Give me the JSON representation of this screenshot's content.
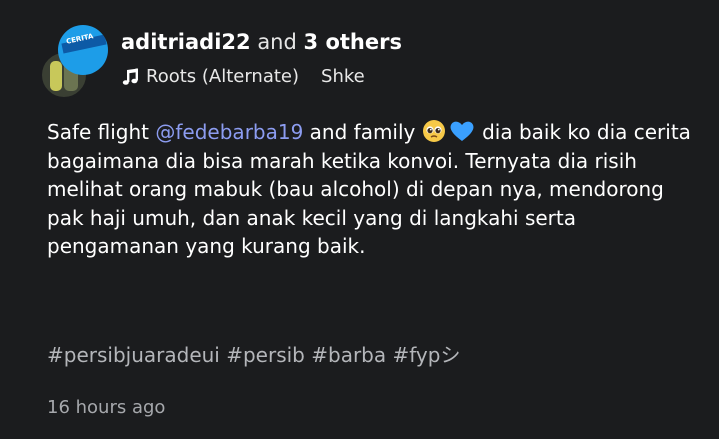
{
  "post": {
    "author": "aditriadi22",
    "coauthor_joiner": "and",
    "coauthor_count": "3 others",
    "avatar_text": "CERITA",
    "music": {
      "icon": "music-note-icon",
      "track": "Roots (Alternate)",
      "artist": "Shke"
    },
    "caption": {
      "part1": "Safe flight ",
      "mention": "@fedebarba19",
      "part2": " and family ",
      "emojis": [
        "pleading-face-emoji",
        "blue-heart-emoji"
      ],
      "part3": " dia baik ko dia cerita bagaimana dia bisa marah ketika konvoi. Ternyata dia risih melihat orang mabuk (bau alcohol) di depan nya, mendorong pak haji umuh, dan anak kecil yang di langkahi serta pengamanan yang kurang baik."
    },
    "hashtags": [
      "#persibjuaradeui",
      "#persib",
      "#barba",
      "#fypシ"
    ],
    "timestamp": "16 hours ago"
  },
  "colors": {
    "background": "#1b1c1e",
    "mention": "#8c9cf0",
    "hashtag": "#b4b6ba",
    "timestamp": "#a6a8ac"
  }
}
